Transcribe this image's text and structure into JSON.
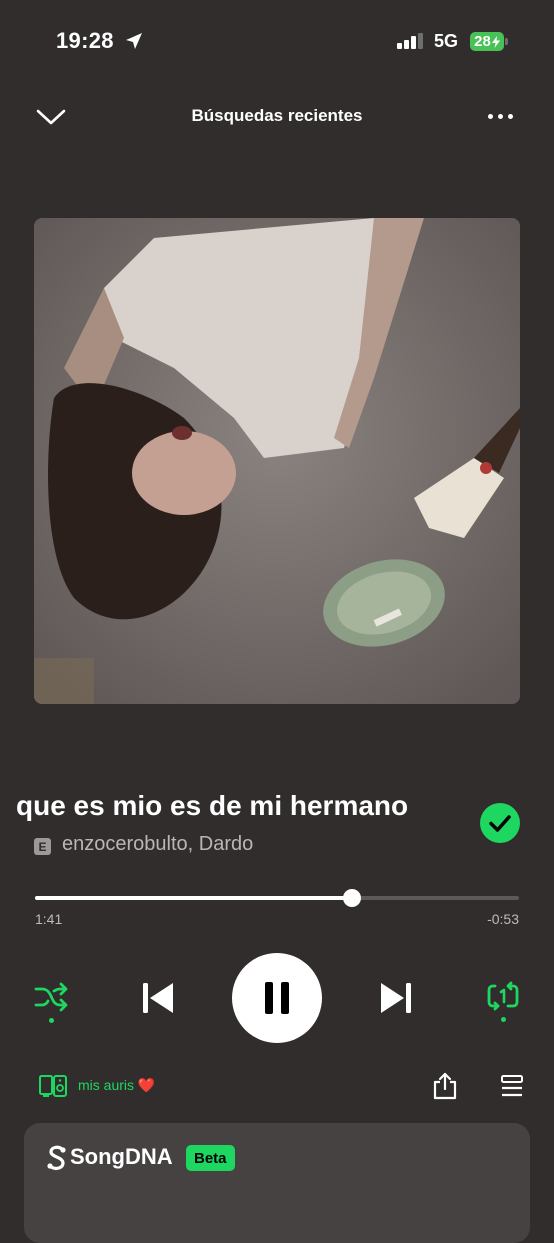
{
  "status_bar": {
    "time": "19:28",
    "network": "5G",
    "battery": "28"
  },
  "header": {
    "title": "Búsquedas recientes",
    "collapse_icon": "chevron-down-icon",
    "more_icon": "more-dots-icon"
  },
  "track": {
    "title": "que es mio es de mi hermano",
    "explicit_badge": "E",
    "artists": "enzocerobulto, Dardo",
    "liked": true
  },
  "progress": {
    "elapsed": "1:41",
    "remaining": "-0:53",
    "fraction": 0.655
  },
  "controls": {
    "shuffle_icon": "shuffle-icon",
    "previous_icon": "skip-previous-icon",
    "play_pause_icon": "pause-icon",
    "next_icon": "skip-next-icon",
    "repeat_icon": "repeat-one-icon"
  },
  "device": {
    "label": "mis auris ❤️"
  },
  "songdna": {
    "title": "SongDNA",
    "badge": "Beta"
  },
  "colors": {
    "background": "#302d2c",
    "accent": "#1ed760",
    "card": "#454241"
  }
}
